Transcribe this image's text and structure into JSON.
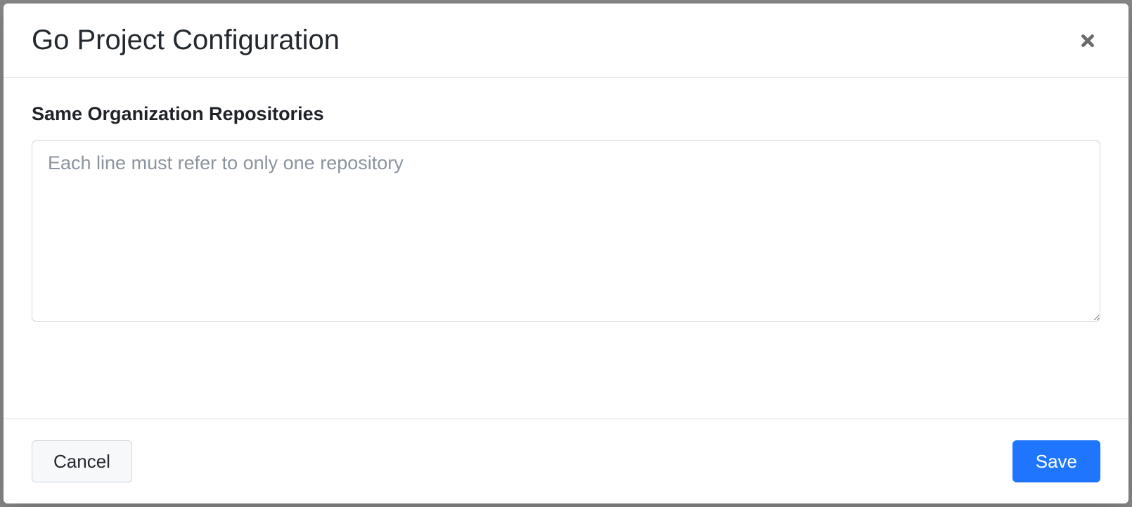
{
  "modal": {
    "title": "Go Project Configuration",
    "close_label": "Close"
  },
  "form": {
    "repos_label": "Same Organization Repositories",
    "repos_placeholder": "Each line must refer to only one repository",
    "repos_value": ""
  },
  "footer": {
    "cancel_label": "Cancel",
    "save_label": "Save"
  },
  "colors": {
    "primary": "#1f75fe",
    "border": "#d0d7de",
    "text": "#24292f",
    "placeholder": "#8b949e"
  }
}
